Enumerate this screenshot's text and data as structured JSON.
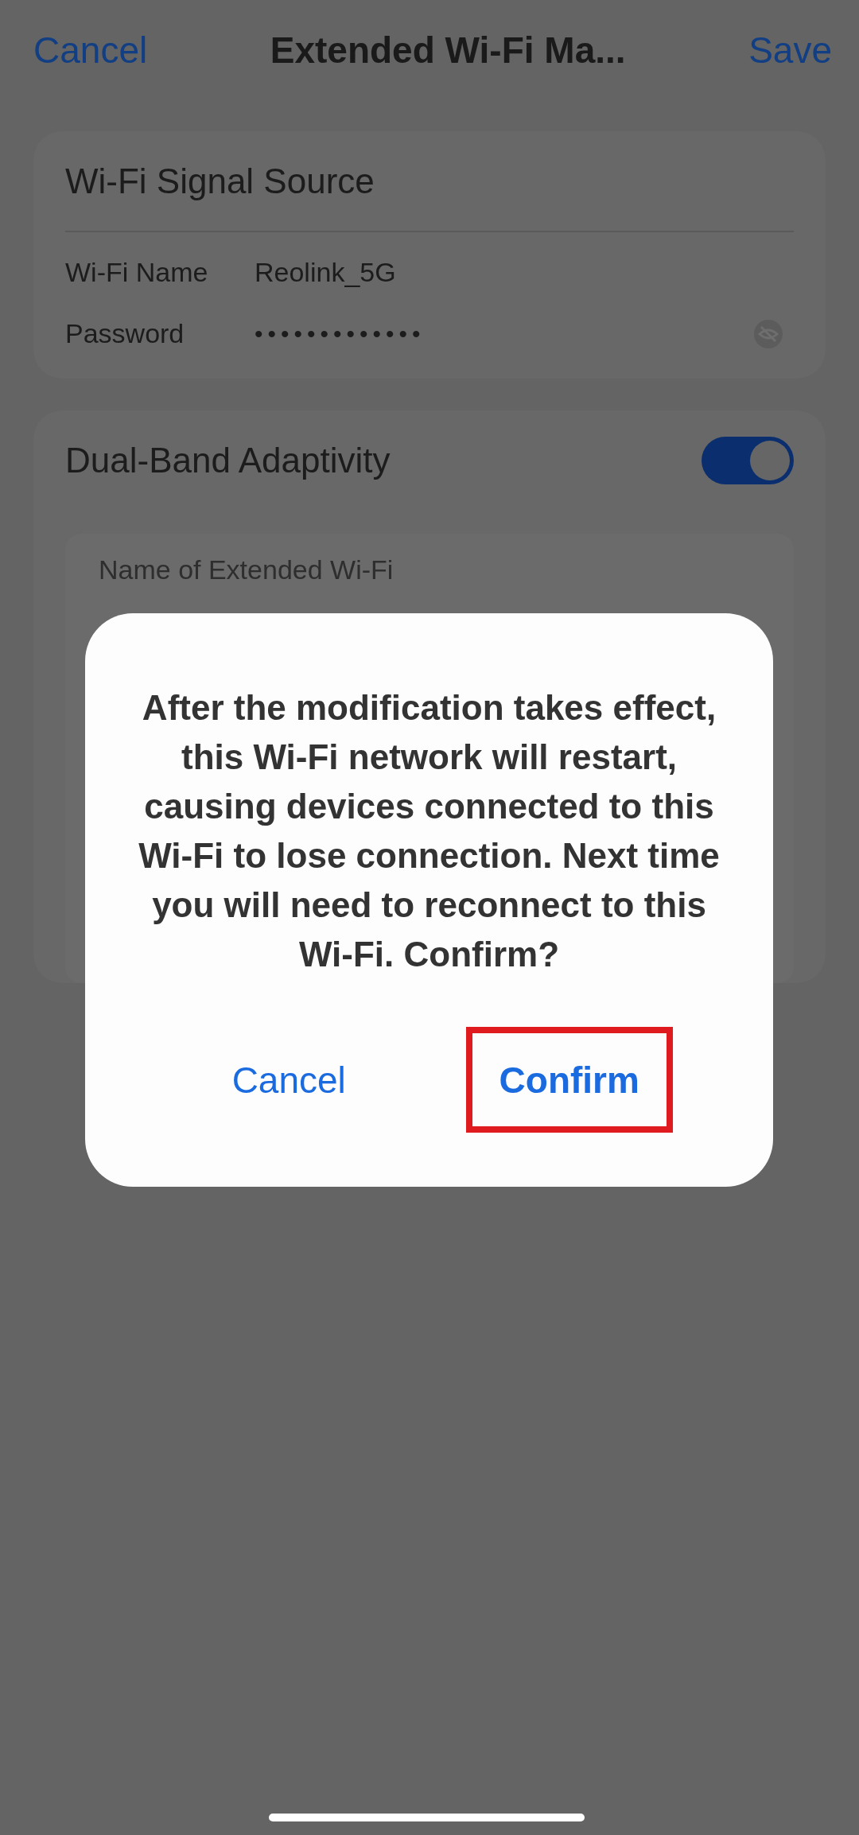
{
  "header": {
    "cancel": "Cancel",
    "title": "Extended Wi-Fi Ma...",
    "save": "Save"
  },
  "signal_source": {
    "title": "Wi-Fi Signal Source",
    "rows": [
      {
        "label": "Wi-Fi Name",
        "value": "Reolink_5G",
        "kind": "text"
      },
      {
        "label": "Password",
        "value": "•••••••••••••",
        "kind": "password"
      }
    ]
  },
  "dual_band": {
    "title": "Dual-Band Adaptivity",
    "on": true,
    "extended_name_label": "Name of Extended Wi-Fi"
  },
  "dialog": {
    "message": "After the modification takes effect, this Wi-Fi network will restart, causing devices connected to this Wi-Fi to lose connection. Next time you will need to reconnect to this Wi-Fi. Confirm?",
    "buttons": [
      {
        "label": "Cancel",
        "kind": "cancel",
        "highlighted": false
      },
      {
        "label": "Confirm",
        "kind": "confirm",
        "highlighted": true
      }
    ]
  }
}
